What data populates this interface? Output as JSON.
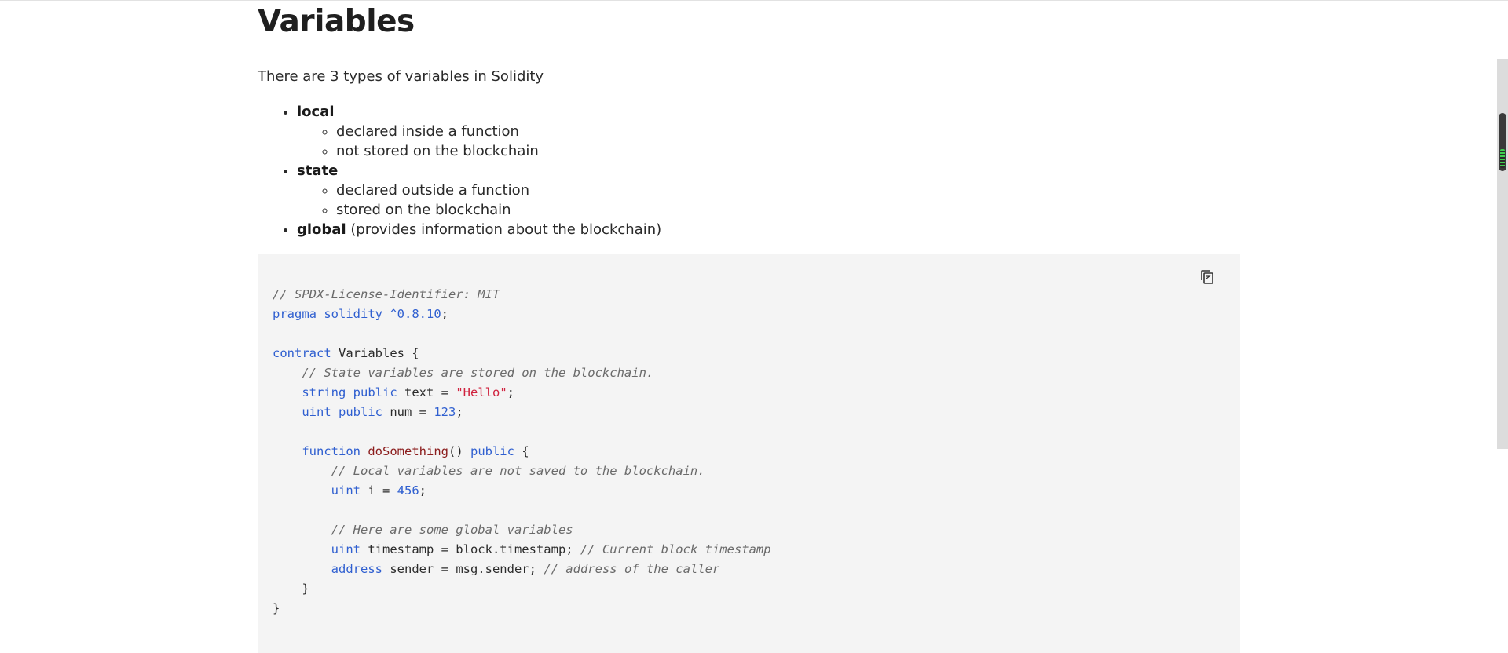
{
  "page": {
    "title": "Variables",
    "intro": "There are 3 types of variables in Solidity"
  },
  "variable_types": [
    {
      "name": "local",
      "details": [
        "declared inside a function",
        "not stored on the blockchain"
      ]
    },
    {
      "name": "state",
      "details": [
        "declared outside a function",
        "stored on the blockchain"
      ]
    },
    {
      "name": "global",
      "note": "(provides information about the blockchain)"
    }
  ],
  "code": {
    "copy_icon": "copy-icon",
    "lines": {
      "l1": "// SPDX-License-Identifier: MIT",
      "l2_kw1": "pragma",
      "l2_kw2": "solidity",
      "l2_ver": "^0.8.10",
      "l4_kw": "contract",
      "l4_name": "Variables",
      "l5": "// State variables are stored on the blockchain.",
      "l6_kw1": "string",
      "l6_kw2": "public",
      "l6_var": "text",
      "l6_str": "\"Hello\"",
      "l7_kw1": "uint",
      "l7_kw2": "public",
      "l7_var": "num",
      "l7_num": "123",
      "l9_kw1": "function",
      "l9_fn": "doSomething",
      "l9_kw2": "public",
      "l10": "// Local variables are not saved to the blockchain.",
      "l11_kw": "uint",
      "l11_var": "i",
      "l11_num": "456",
      "l13": "// Here are some global variables",
      "l14_kw": "uint",
      "l14_expr": "timestamp = block.timestamp;",
      "l14_cmt": "// Current block timestamp",
      "l15_kw": "address",
      "l15_expr": "sender = msg.sender;",
      "l15_cmt": "// address of the caller"
    }
  }
}
